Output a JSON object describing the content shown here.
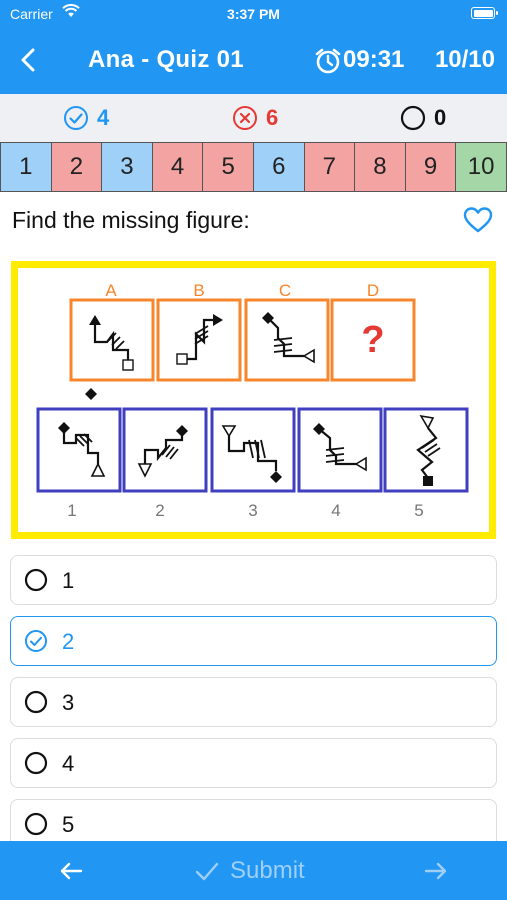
{
  "status_bar": {
    "carrier": "Carrier",
    "time": "3:37 PM"
  },
  "nav": {
    "title": "Ana - Quiz 01",
    "timer": "09:31",
    "progress": "10/10"
  },
  "score": {
    "correct": "4",
    "wrong": "6",
    "unanswered": "0"
  },
  "question_grid": [
    {
      "number": "1",
      "state": "correct"
    },
    {
      "number": "2",
      "state": "wrong"
    },
    {
      "number": "3",
      "state": "correct"
    },
    {
      "number": "4",
      "state": "wrong"
    },
    {
      "number": "5",
      "state": "wrong"
    },
    {
      "number": "6",
      "state": "correct"
    },
    {
      "number": "7",
      "state": "wrong"
    },
    {
      "number": "8",
      "state": "wrong"
    },
    {
      "number": "9",
      "state": "wrong"
    },
    {
      "number": "10",
      "state": "current"
    }
  ],
  "question": {
    "text": "Find the missing figure:"
  },
  "figure": {
    "top_labels": [
      "A",
      "B",
      "C",
      "D"
    ],
    "missing_mark": "?",
    "bottom_labels": [
      "1",
      "2",
      "3",
      "4",
      "5"
    ]
  },
  "options": [
    {
      "label": "1",
      "selected": false
    },
    {
      "label": "2",
      "selected": true
    },
    {
      "label": "3",
      "selected": false
    },
    {
      "label": "4",
      "selected": false
    },
    {
      "label": "5",
      "selected": false
    }
  ],
  "bottom_bar": {
    "submit_label": "Submit"
  },
  "colors": {
    "primary": "#2196F3",
    "correct": "#9ED0F8",
    "wrong": "#F4A3A3",
    "current": "#A5D6A7",
    "figure_top_border": "#F7852B",
    "figure_bottom_border": "#3F3FBF",
    "figure_frame": "#FFEB00",
    "missing_mark": "#E53935"
  }
}
